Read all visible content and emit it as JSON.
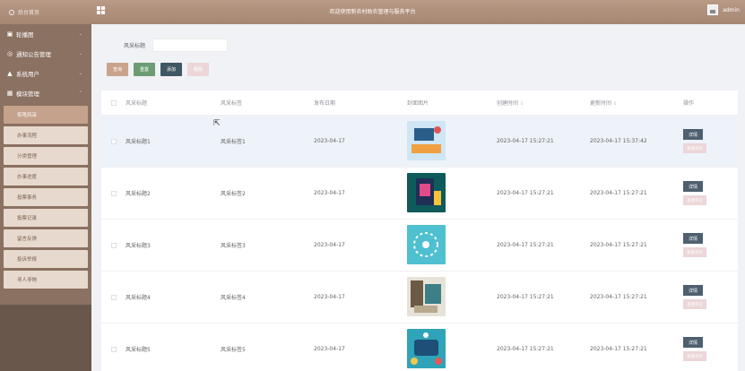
{
  "topbar": {
    "home_label": "后台首页",
    "welcome": "欢迎使用新农村助农管理与服务平台",
    "username": "admin"
  },
  "sidebar": {
    "menus": [
      {
        "icon": "image-icon",
        "glyph": "▣",
        "label": "轮播图",
        "chevron": "⌄"
      },
      {
        "icon": "notice-icon",
        "glyph": "◎",
        "label": "通知公告管理",
        "chevron": "⌄"
      },
      {
        "icon": "user-icon",
        "glyph": "▲",
        "label": "系统用户",
        "chevron": "⌄"
      },
      {
        "icon": "grid-icon",
        "glyph": "▦",
        "label": "模块管理",
        "chevron": "⌃"
      }
    ],
    "subitems": [
      "惊艳风采",
      "办事流程",
      "分类管理",
      "办事进度",
      "投票事务",
      "投票记录",
      "留言反馈",
      "投诉举报",
      "寻人寻物"
    ],
    "active_index": 0
  },
  "search": {
    "label": "风采标题",
    "value": ""
  },
  "buttons": {
    "query": "查询",
    "reset": "重置",
    "add": "添加",
    "delete": "删除"
  },
  "table": {
    "headers": [
      "风采标题",
      "风采标签",
      "发布日期",
      "封面图片",
      "创建时间",
      "更新时间",
      "操作"
    ],
    "sort_glyph": "⇕",
    "detail_label": "详情",
    "comment_label": "查看评论",
    "rows": [
      {
        "title": "风采标题1",
        "tag": "风采标签1",
        "date": "2023-04-17",
        "created": "2023-04-17 15:27:21",
        "updated": "2023-04-17 15:37:42",
        "thumb": "thumb-1"
      },
      {
        "title": "风采标题2",
        "tag": "风采标签2",
        "date": "2023-04-17",
        "created": "2023-04-17 15:27:21",
        "updated": "2023-04-17 15:27:21",
        "thumb": "thumb-2"
      },
      {
        "title": "风采标题3",
        "tag": "风采标签3",
        "date": "2023-04-17",
        "created": "2023-04-17 15:27:21",
        "updated": "2023-04-17 15:27:21",
        "thumb": "thumb-3"
      },
      {
        "title": "风采标题4",
        "tag": "风采标签4",
        "date": "2023-04-17",
        "created": "2023-04-17 15:27:21",
        "updated": "2023-04-17 15:27:21",
        "thumb": "thumb-4"
      },
      {
        "title": "风采标题5",
        "tag": "风采标签5",
        "date": "2023-04-17",
        "created": "2023-04-17 15:27:21",
        "updated": "2023-04-17 15:27:21",
        "thumb": "thumb-5"
      }
    ]
  },
  "colors": {
    "topbar": "#a58772",
    "sidebar": "#8b7161",
    "active_sub": "#c4a28b",
    "detail_button": "#4e6070"
  }
}
